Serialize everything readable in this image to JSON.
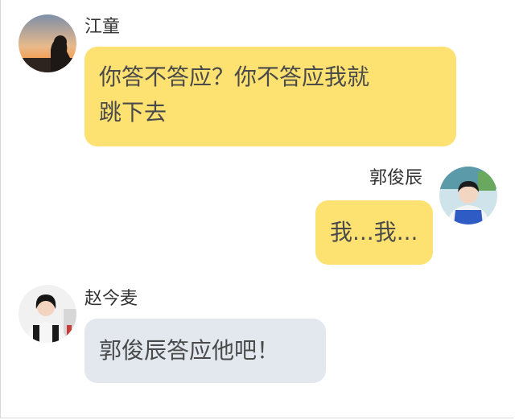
{
  "messages": [
    {
      "sender": "江童",
      "side": "left",
      "avatar_icon": "sunset-silhouette-avatar-icon",
      "bubble_color": "#fde171",
      "lines": [
        "你答不答应？你不答应我就",
        "跳下去"
      ]
    },
    {
      "sender": "郭俊辰",
      "side": "right",
      "avatar_icon": "boy-in-blue-overalls-avatar-icon",
      "bubble_color": "#fde171",
      "lines": [
        "我...我..."
      ]
    },
    {
      "sender": "赵今麦",
      "side": "left",
      "avatar_icon": "girl-with-backpack-avatar-icon",
      "bubble_color": "#e3e8ef",
      "lines": [
        "郭俊辰答应他吧！"
      ]
    }
  ]
}
